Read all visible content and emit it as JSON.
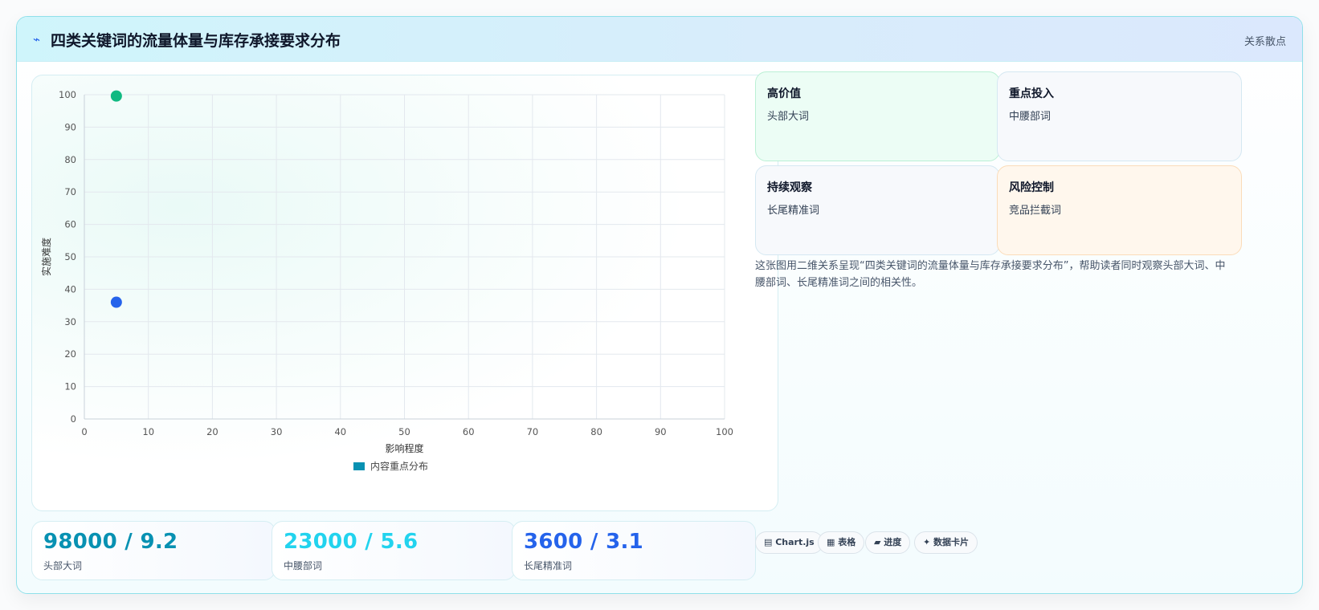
{
  "header": {
    "icon": "lightning-icon",
    "title": "四类关键词的流量体量与库存承接要求分布",
    "tag": "关系散点"
  },
  "chart_data": {
    "type": "scatter",
    "xlabel": "影响程度",
    "ylabel": "实施难度",
    "xlim": [
      0,
      100
    ],
    "ylim": [
      0,
      100
    ],
    "xticks": [
      "0",
      "10",
      "20",
      "30",
      "40",
      "50",
      "60",
      "70",
      "80",
      "90",
      "100"
    ],
    "yticks": [
      "0",
      "10",
      "20",
      "30",
      "40",
      "50",
      "60",
      "70",
      "80",
      "90",
      "100"
    ],
    "grid": true,
    "legend_position": "bottom",
    "series": [
      {
        "name": "内容重点分布",
        "legend_color": "#0891b2",
        "points": [
          {
            "x": 5,
            "y": 99.6,
            "color": "#10b981"
          },
          {
            "x": 5,
            "y": 36,
            "color": "#2563eb"
          }
        ]
      }
    ]
  },
  "stats": [
    {
      "value": "98000 / 9.2",
      "label": "头部大词",
      "color": "#0891b2"
    },
    {
      "value": "23000 / 5.6",
      "label": "中腰部词",
      "color": "#22d3ee"
    },
    {
      "value": "3600 / 3.1",
      "label": "长尾精准词",
      "color": "#2563eb"
    }
  ],
  "quadrants": [
    {
      "title": "高价值",
      "desc": "头部大词",
      "bg": "#ecfdf5",
      "border": "#bbf0d5"
    },
    {
      "title": "重点投入",
      "desc": "中腰部词",
      "bg": "#f7f9fc",
      "border": "#d5e8f2"
    },
    {
      "title": "持续观察",
      "desc": "长尾精准词",
      "bg": "#f7f9fc",
      "border": "#d5e8f2"
    },
    {
      "title": "风险控制",
      "desc": "竞品拦截词",
      "bg": "#fff7ed",
      "border": "#fbdcb9"
    }
  ],
  "description": "这张图用二维关系呈现“四类关键词的流量体量与库存承接要求分布”，帮助读者同时观察头部大词、中腰部词、长尾精准词之间的相关性。",
  "chips": [
    {
      "label": "▤ Chart.js"
    },
    {
      "label": "▦ 表格"
    },
    {
      "label": "▰ 进度"
    },
    {
      "label": "✦ 数据卡片"
    }
  ]
}
